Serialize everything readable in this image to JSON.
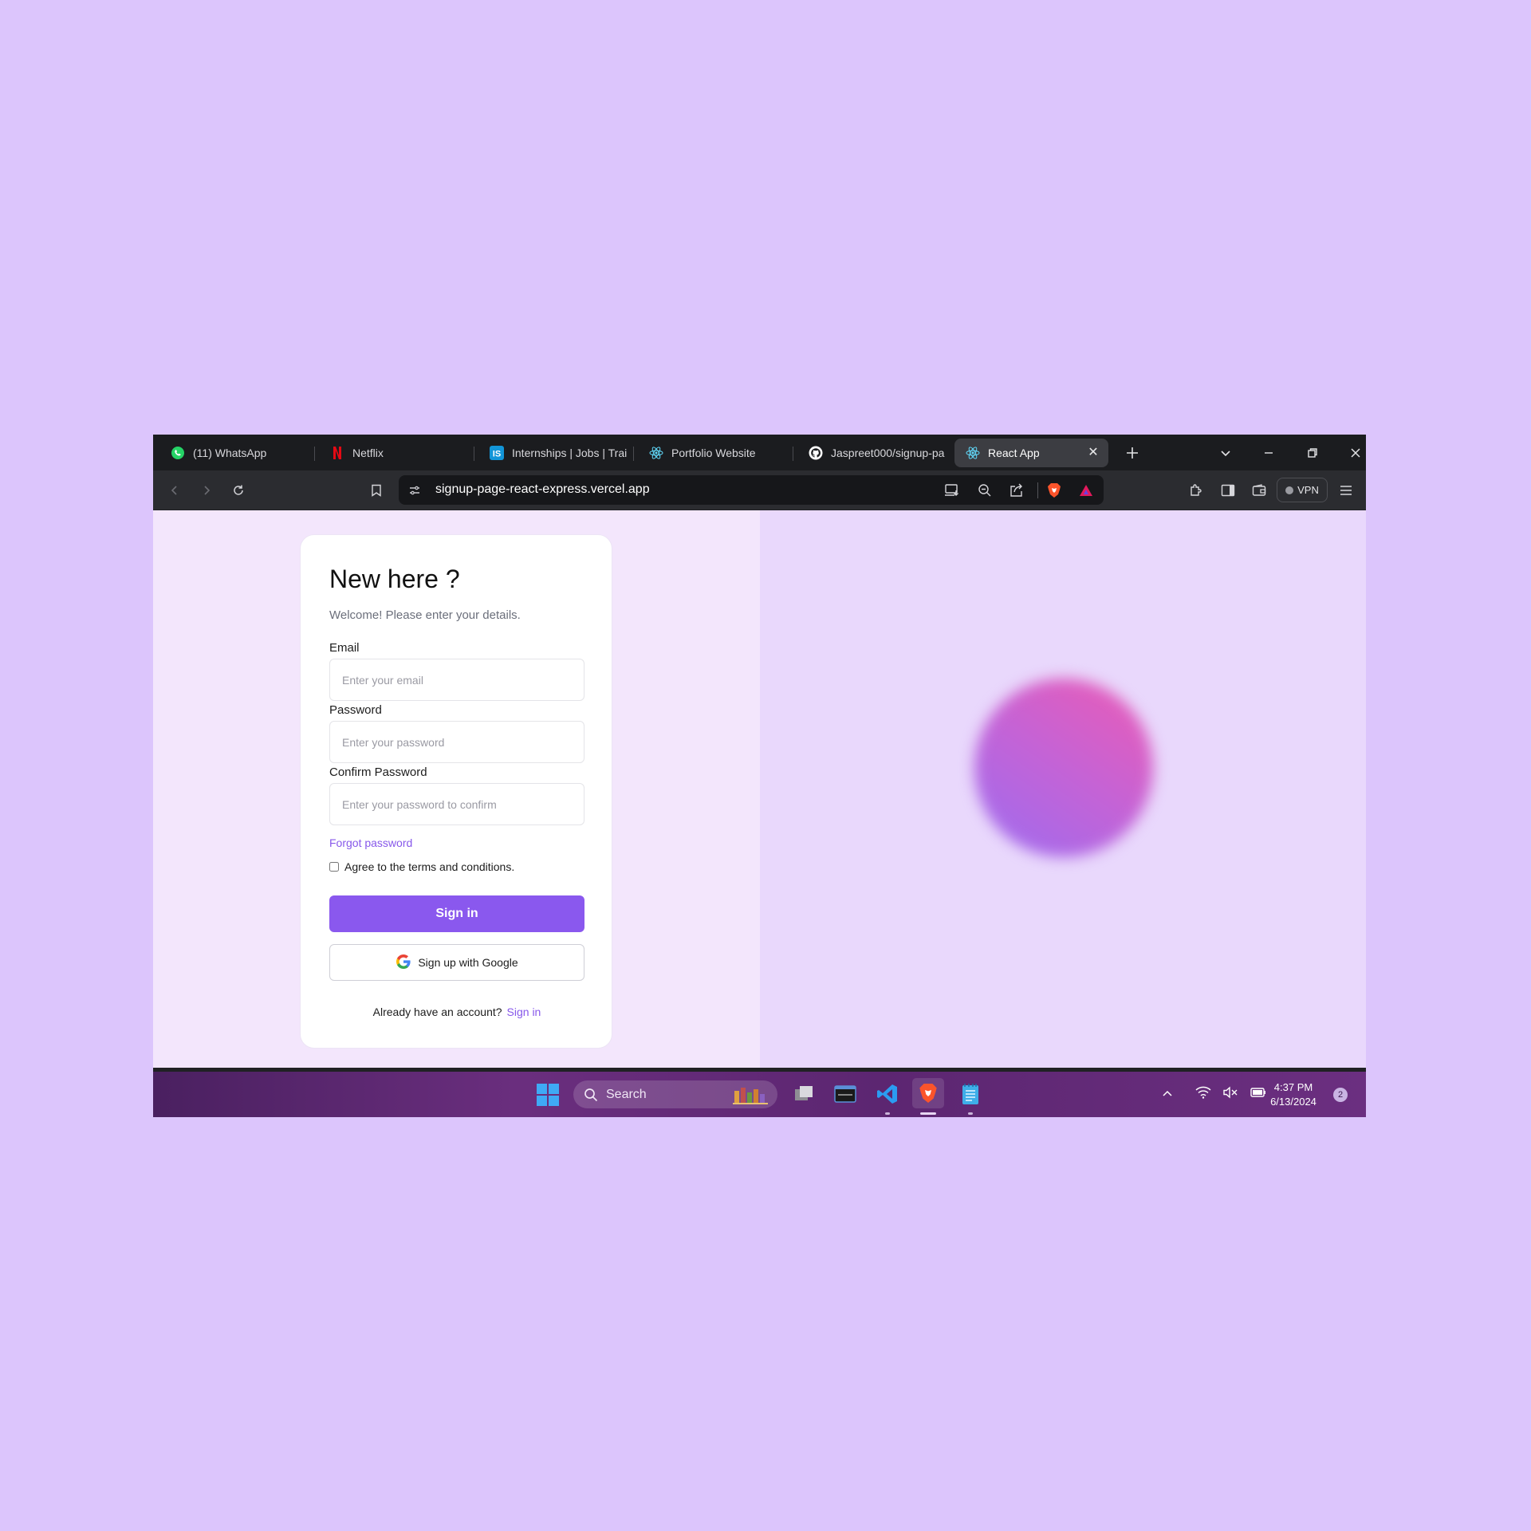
{
  "browser": {
    "tabs": [
      {
        "title": "(11) WhatsApp",
        "icon": "whatsapp-icon"
      },
      {
        "title": "Netflix",
        "icon": "netflix-icon"
      },
      {
        "title": "Internships | Jobs | Trai",
        "icon": "internshala-icon"
      },
      {
        "title": "Portfolio Website",
        "icon": "react-icon"
      },
      {
        "title": "Jaspreet000/signup-pa",
        "icon": "github-icon"
      },
      {
        "title": "React App",
        "icon": "react-icon",
        "active": true
      }
    ],
    "url": "signup-page-react-express.vercel.app",
    "vpn_label": "VPN"
  },
  "form": {
    "heading": "New here ?",
    "subtitle": "Welcome! Please enter your details.",
    "email_label": "Email",
    "email_placeholder": "Enter your email",
    "password_label": "Password",
    "password_placeholder": "Enter your password",
    "confirm_label": "Confirm Password",
    "confirm_placeholder": "Enter your password to confirm",
    "forgot_password": "Forgot password",
    "terms_label": "Agree to the terms and conditions.",
    "signin_button": "Sign in",
    "google_button": "Sign up with Google",
    "have_account_text": "Already have an account?",
    "signin_link": "Sign in"
  },
  "taskbar": {
    "search_label": "Search",
    "time": "4:37 PM",
    "date": "6/13/2024",
    "notification_count": "2"
  },
  "colors": {
    "accent": "#8a58ee",
    "desktop_bg": "#dcc5fc",
    "left_pane_bg": "#f3e6fc",
    "right_pane_bg": "#e9d8fc"
  }
}
